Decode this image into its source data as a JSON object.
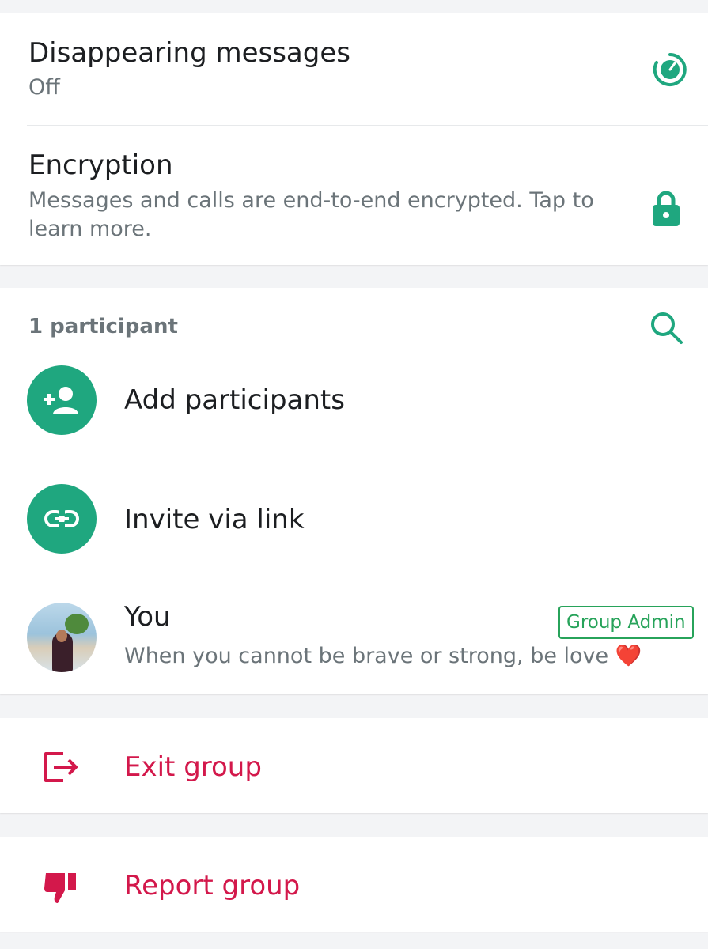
{
  "settings": {
    "disappearing": {
      "title": "Disappearing messages",
      "value": "Off",
      "icon": "timer-icon"
    },
    "encryption": {
      "title": "Encryption",
      "description": "Messages and calls are end-to-end encrypted. Tap to learn more.",
      "icon": "lock-icon"
    }
  },
  "participants": {
    "count_label": "1 participant",
    "search_icon": "search-icon",
    "add_label": "Add participants",
    "invite_label": "Invite via link",
    "members": [
      {
        "name": "You",
        "status": "When you cannot be brave or strong, be love ❤️",
        "badge": "Group Admin"
      }
    ]
  },
  "actions": {
    "exit_label": "Exit group",
    "report_label": "Report group"
  },
  "colors": {
    "accent": "#1fa77f",
    "danger": "#d3184b",
    "admin_badge": "#27a35a"
  }
}
